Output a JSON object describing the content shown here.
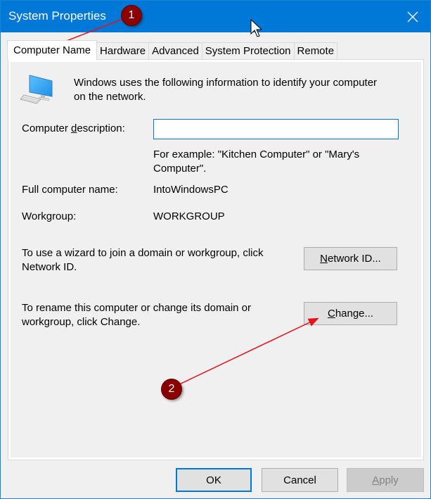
{
  "window": {
    "title": "System Properties",
    "close_icon": "close-icon"
  },
  "tabs": [
    {
      "label": "Computer Name",
      "active": true
    },
    {
      "label": "Hardware",
      "active": false
    },
    {
      "label": "Advanced",
      "active": false
    },
    {
      "label": "System Protection",
      "active": false
    },
    {
      "label": "Remote",
      "active": false
    }
  ],
  "computer_name": {
    "icon": "computer-icon",
    "intro_line1": "Windows uses the following information to identify your computer",
    "intro_line2": "on the network.",
    "description_label_pre": "Computer ",
    "description_label_key": "d",
    "description_label_post": "escription:",
    "description_value": "",
    "example_line1": "For example: \"Kitchen Computer\" or \"Mary's",
    "example_line2": "Computer\".",
    "full_name_label": "Full computer name:",
    "full_name_value": "IntoWindowsPC",
    "workgroup_label": "Workgroup:",
    "workgroup_value": "WORKGROUP",
    "network_text_line1": "To use a wizard to join a domain or workgroup, click",
    "network_text_line2": "Network ID.",
    "network_button_key": "N",
    "network_button_rest": "etwork ID...",
    "change_text_line1": "To rename this computer or change its domain or",
    "change_text_line2": "workgroup, click Change.",
    "change_button_key": "C",
    "change_button_rest": "hange..."
  },
  "footer": {
    "ok_label": "OK",
    "cancel_label": "Cancel",
    "apply_key": "A",
    "apply_rest": "pply"
  },
  "annotations": [
    {
      "number": "1",
      "color": "#8b0000"
    },
    {
      "number": "2",
      "color": "#8b0000"
    }
  ],
  "colors": {
    "titlebar": "#0078d7",
    "arrow": "#e8141b"
  }
}
